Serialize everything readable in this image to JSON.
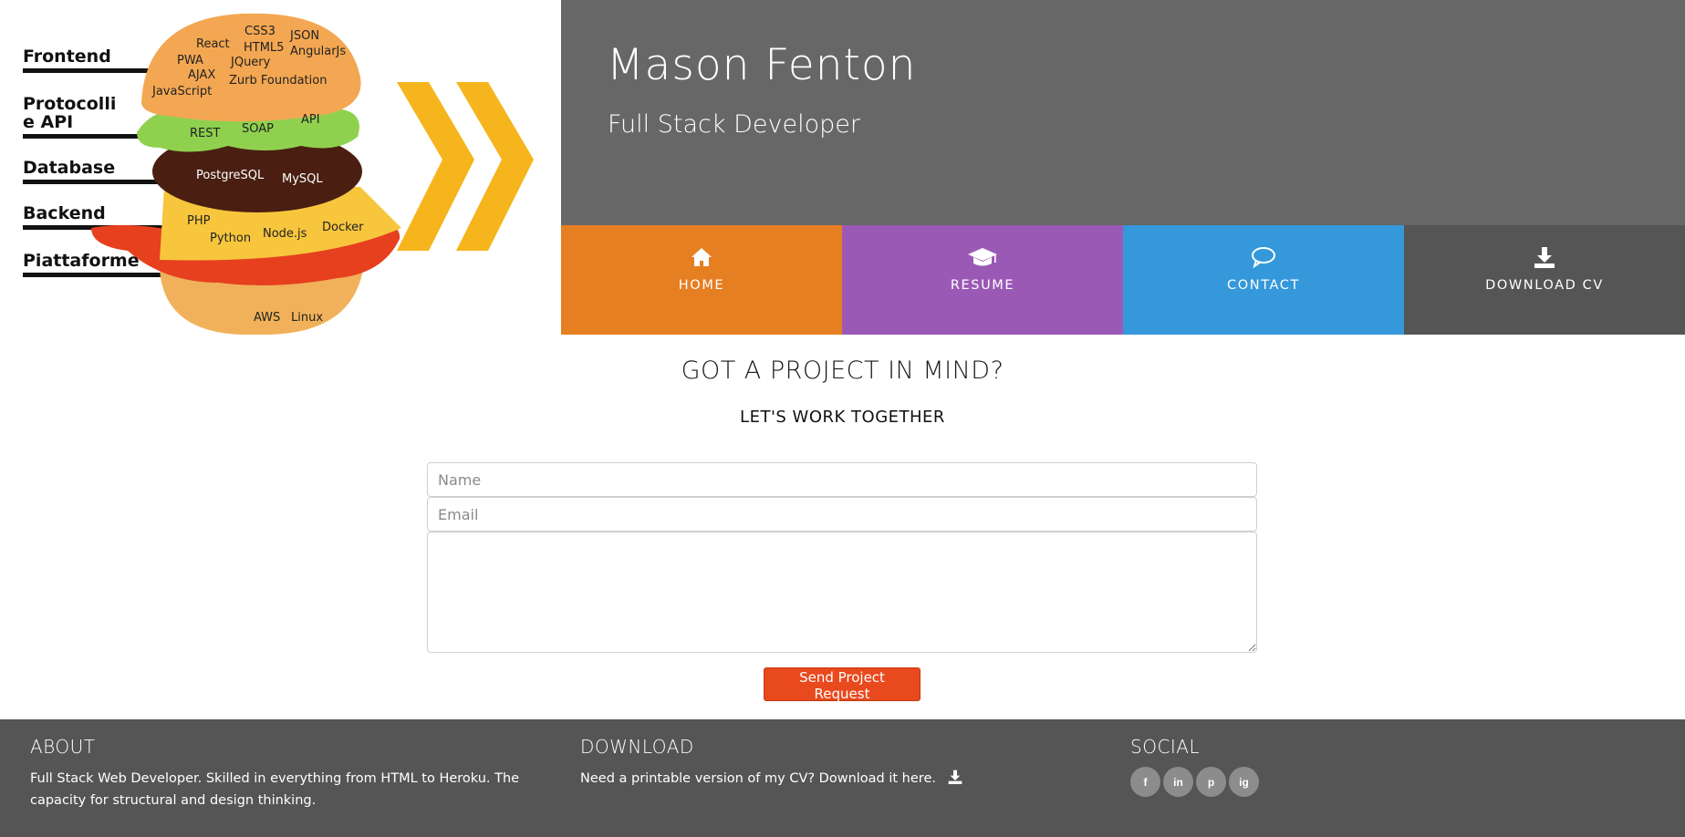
{
  "header": {
    "name": "Mason Fenton",
    "role": "Full Stack Developer",
    "background_color": "#676767"
  },
  "hero_image": {
    "layers": [
      "Frontend",
      "Protocolli e API",
      "Database",
      "Backend",
      "Piattaforme"
    ],
    "protocolli_line1": "Protocolli",
    "protocolli_line2": "e API",
    "frontend_tags": [
      "CSS3",
      "JSON",
      "React",
      "HTML5",
      "AngularJs",
      "PWA",
      "JQuery",
      "AJAX",
      "Zurb Foundation",
      "JavaScript"
    ],
    "api_tags": [
      "REST",
      "SOAP",
      "API"
    ],
    "database_tags": [
      "PostgreSQL",
      "MySQL"
    ],
    "backend_tags": [
      "PHP",
      "Python",
      "Node.js",
      "Docker"
    ],
    "platform_tags": [
      "AWS",
      "Linux"
    ]
  },
  "nav": {
    "items": [
      {
        "label": "HOME",
        "icon": "home-icon",
        "color": "#e67e22"
      },
      {
        "label": "RESUME",
        "icon": "graduation-cap-icon",
        "color": "#9b59b6"
      },
      {
        "label": "CONTACT",
        "icon": "chat-bubble-icon",
        "color": "#3498db"
      },
      {
        "label": "DOWNLOAD CV",
        "icon": "download-icon",
        "color": "#555555"
      }
    ]
  },
  "main": {
    "title": "GOT A PROJECT IN MIND?",
    "subtitle": "LET'S WORK TOGETHER",
    "form": {
      "name_placeholder": "Name",
      "email_placeholder": "Email",
      "message_placeholder": "",
      "submit_label": "Send Project Request",
      "submit_color": "#e8491d"
    }
  },
  "footer": {
    "about": {
      "heading": "ABOUT",
      "text": "Full Stack Web Developer. Skilled in everything from HTML to Heroku. The capacity for structural and design thinking."
    },
    "download": {
      "heading": "DOWNLOAD",
      "text": "Need a printable version of my CV? Download it here."
    },
    "social": {
      "heading": "SOCIAL",
      "links": [
        {
          "icon": "facebook-icon",
          "glyph": "f"
        },
        {
          "icon": "linkedin-icon",
          "glyph": "in"
        },
        {
          "icon": "pinterest-icon",
          "glyph": "p"
        },
        {
          "icon": "instagram-icon",
          "glyph": "ig"
        }
      ]
    }
  }
}
